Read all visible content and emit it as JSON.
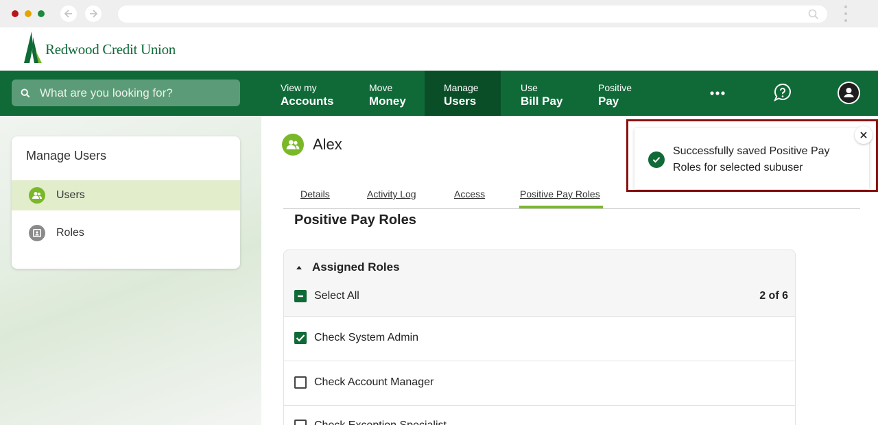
{
  "colors": {
    "brand_green": "#0f6a37",
    "accent_lime": "#7ab829",
    "highlight_border": "#8b1010",
    "traffic_lights": [
      "#b8151b",
      "#e4a400",
      "#1a8a3c"
    ]
  },
  "browser": {
    "icons": [
      "back-arrow-icon",
      "forward-arrow-icon",
      "search-icon",
      "kebab-menu-icon"
    ]
  },
  "brand": {
    "name": "Redwood Credit Union"
  },
  "search": {
    "placeholder": "What are you looking for?"
  },
  "nav": {
    "items": [
      {
        "line1": "View my",
        "line2": "Accounts",
        "active": false
      },
      {
        "line1": "Move",
        "line2": "Money",
        "active": false
      },
      {
        "line1": "Manage",
        "line2": "Users",
        "active": true
      },
      {
        "line1": "Use",
        "line2": "Bill Pay",
        "active": false
      },
      {
        "line1": "Positive",
        "line2": "Pay",
        "active": false
      }
    ],
    "icons": [
      "more-icon",
      "help-chat-icon",
      "profile-icon"
    ]
  },
  "sidebar": {
    "title": "Manage Users",
    "items": [
      {
        "label": "Users",
        "icon": "users-icon",
        "active": true
      },
      {
        "label": "Roles",
        "icon": "roles-icon",
        "active": false
      }
    ]
  },
  "user": {
    "name": "Alex"
  },
  "tabs": [
    {
      "label": "Details",
      "active": false
    },
    {
      "label": "Activity Log",
      "active": false
    },
    {
      "label": "Access",
      "active": false
    },
    {
      "label": "Positive Pay Roles",
      "active": true
    }
  ],
  "section": {
    "title": "Positive Pay Roles"
  },
  "roles": {
    "header": "Assigned Roles",
    "select_all": "Select All",
    "count": "2 of 6",
    "items": [
      {
        "label": "Check System Admin",
        "checked": true
      },
      {
        "label": "Check Account Manager",
        "checked": false
      },
      {
        "label": "Check Exception Specialist",
        "checked": false
      }
    ]
  },
  "toast": {
    "message": "Successfully saved Positive Pay Roles for selected subuser"
  }
}
